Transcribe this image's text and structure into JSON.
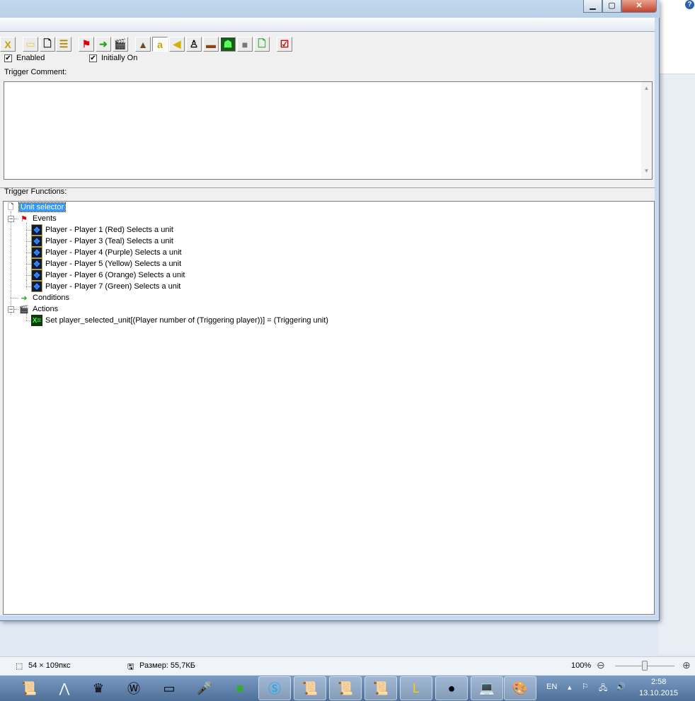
{
  "window": {
    "minimize_icon": "minimize-icon",
    "maximize_icon": "maximize-icon",
    "close_icon": "close-icon"
  },
  "help_icon": "?",
  "toolbar": {
    "buttons": [
      "close-trigger",
      "open-folder",
      "new-document",
      "list",
      "event-flag",
      "condition",
      "action",
      "terrain",
      "text",
      "sound",
      "unit",
      "item",
      "region",
      "model",
      "new-trigger",
      "edit"
    ]
  },
  "options": {
    "enabled_label": "Enabled",
    "enabled_checked": true,
    "initially_on_label": "Initially On",
    "initially_on_checked": true
  },
  "comment": {
    "label": "Trigger Comment:",
    "value": ""
  },
  "functions": {
    "label": "Trigger Functions:",
    "trigger_name": "Unit selector",
    "events_label": "Events",
    "events": [
      "Player - Player 1 (Red) Selects a unit",
      "Player - Player 3 (Teal) Selects a unit",
      "Player - Player 4 (Purple) Selects a unit",
      "Player - Player 5 (Yellow) Selects a unit",
      "Player - Player 6 (Orange) Selects a unit",
      "Player - Player 7 (Green) Selects a unit"
    ],
    "conditions_label": "Conditions",
    "actions_label": "Actions",
    "actions": [
      "Set player_selected_unit[(Player number of (Triggering player))] = (Triggering unit)"
    ]
  },
  "statusbar": {
    "dimensions": "54 × 109пкс",
    "size": "Размер: 55,7КБ",
    "zoom": "100%",
    "zoom_level_percent": 100
  },
  "taskbar": {
    "lang": "EN",
    "time": "2:58",
    "date": "13.10.2015"
  }
}
